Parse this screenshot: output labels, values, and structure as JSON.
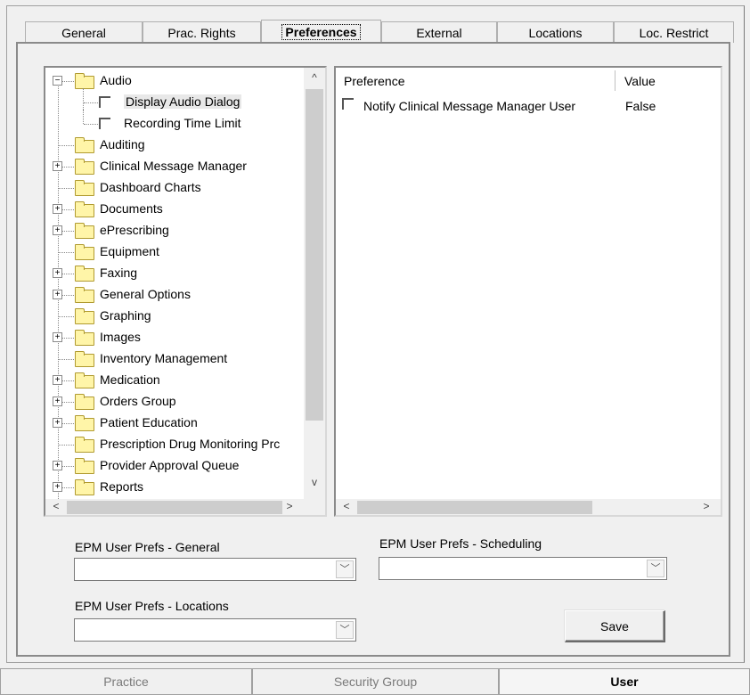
{
  "tabs": [
    {
      "label": "General"
    },
    {
      "label": "Prac. Rights"
    },
    {
      "label": "Preferences",
      "active": true
    },
    {
      "label": "External"
    },
    {
      "label": "Locations"
    },
    {
      "label": "Loc. Restrict"
    }
  ],
  "tree": {
    "items": [
      {
        "label": "Audio",
        "expanded": true
      },
      {
        "label": "Display Audio Dialog",
        "selected": true
      },
      {
        "label": "Recording Time Limit"
      },
      {
        "label": "Auditing"
      },
      {
        "label": "Clinical Message Manager",
        "expandable": true
      },
      {
        "label": "Dashboard Charts"
      },
      {
        "label": "Documents",
        "expandable": true
      },
      {
        "label": "ePrescribing",
        "expandable": true
      },
      {
        "label": "Equipment"
      },
      {
        "label": "Faxing",
        "expandable": true
      },
      {
        "label": "General Options",
        "expandable": true
      },
      {
        "label": "Graphing"
      },
      {
        "label": "Images",
        "expandable": true
      },
      {
        "label": "Inventory Management"
      },
      {
        "label": "Medication",
        "expandable": true
      },
      {
        "label": "Orders Group",
        "expandable": true
      },
      {
        "label": "Patient Education",
        "expandable": true
      },
      {
        "label": "Prescription Drug Monitoring Prc"
      },
      {
        "label": "Provider Approval Queue",
        "expandable": true
      },
      {
        "label": "Reports",
        "expandable": true
      }
    ],
    "expand_symbol": "+",
    "collapse_symbol": "−"
  },
  "scroll": {
    "up": "^",
    "down": "v",
    "left": "<",
    "right": ">"
  },
  "list": {
    "columns": [
      "Preference",
      "Value"
    ],
    "rows": [
      {
        "preference": "Notify Clinical Message Manager User",
        "value": "False",
        "checked": false
      }
    ]
  },
  "dropdowns": {
    "general": {
      "label": "EPM User Prefs - General",
      "value": ""
    },
    "scheduling": {
      "label": "EPM User Prefs - Scheduling",
      "value": ""
    },
    "locations": {
      "label": "EPM User Prefs - Locations",
      "value": ""
    },
    "arrow": "﹀"
  },
  "save_label": "Save",
  "bottom_tabs": [
    {
      "label": "Practice"
    },
    {
      "label": "Security Group"
    },
    {
      "label": "User",
      "active": true
    }
  ],
  "colors": {
    "folder_fill": "#fff5a8",
    "background": "#f0f0f0"
  }
}
